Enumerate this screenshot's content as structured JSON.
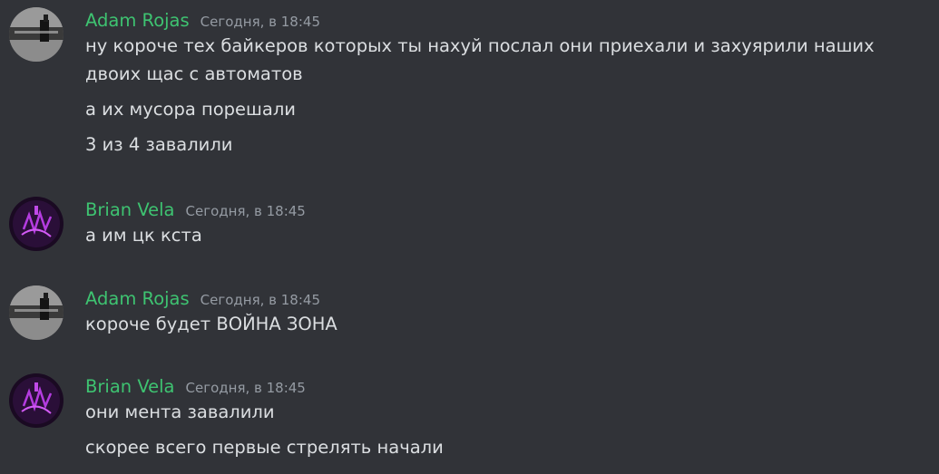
{
  "messages": [
    {
      "author": "Adam Rojas",
      "timestamp": "Сегодня, в 18:45",
      "avatar_icon": "user-avatar-dark-photo",
      "lines": [
        "ну короче тех байкеров которых ты нахуй послал они приехали и захуярили наших",
        "двоих щас с автоматов",
        "а их мусора порешали",
        "3 из 4 завалили"
      ]
    },
    {
      "author": "Brian Vela",
      "timestamp": "Сегодня, в 18:45",
      "avatar_icon": "user-avatar-purple-graffiti",
      "lines": [
        "а им цк кста"
      ]
    },
    {
      "author": "Adam Rojas",
      "timestamp": "Сегодня, в 18:45",
      "avatar_icon": "user-avatar-dark-photo",
      "lines": [
        "короче будет ВОЙНА ЗОНА"
      ]
    },
    {
      "author": "Brian Vela",
      "timestamp": "Сегодня, в 18:45",
      "avatar_icon": "user-avatar-purple-graffiti",
      "lines": [
        "они мента завалили",
        "скорее всего первые стрелять начали"
      ]
    }
  ],
  "colors": {
    "background": "#313338",
    "username": "#3ec371",
    "timestamp": "#959ba3",
    "text": "#dbdee1"
  }
}
